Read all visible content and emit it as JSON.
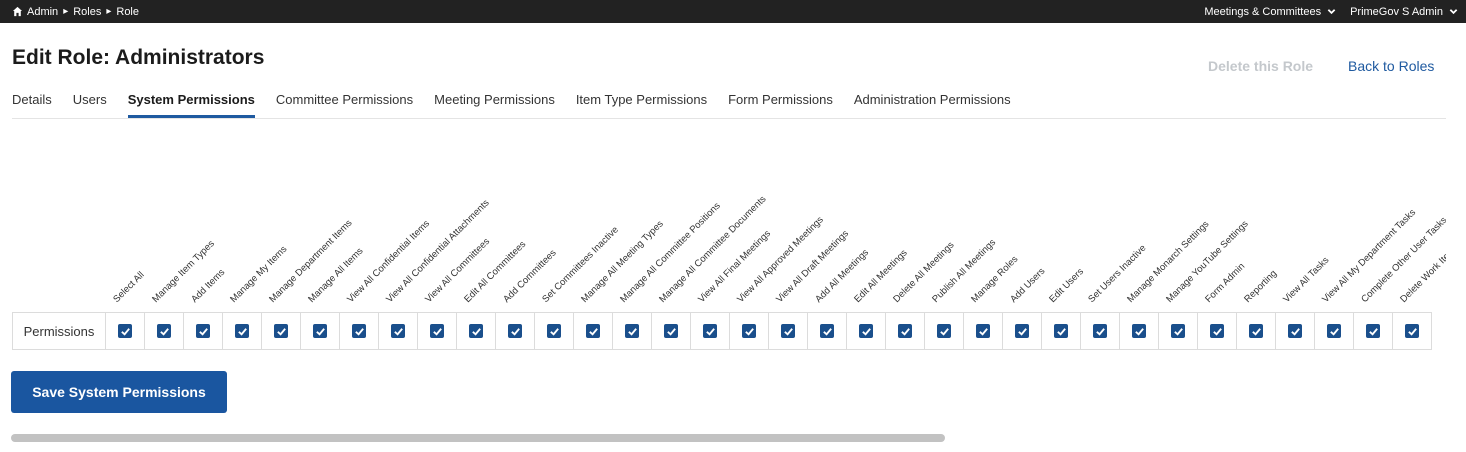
{
  "breadcrumb": [
    "Admin",
    "Roles",
    "Role"
  ],
  "topbar": {
    "meetings_menu": "Meetings & Committees",
    "user_menu": "PrimeGov S Admin"
  },
  "page": {
    "title": "Edit Role: Administrators",
    "delete_link": "Delete this Role",
    "back_link": "Back to Roles"
  },
  "tabs": [
    "Details",
    "Users",
    "System Permissions",
    "Committee Permissions",
    "Meeting Permissions",
    "Item Type Permissions",
    "Form Permissions",
    "Administration Permissions"
  ],
  "active_tab": "System Permissions",
  "permissions": {
    "row_label": "Permissions",
    "columns": [
      "Select All",
      "Manage Item Types",
      "Add Items",
      "Manage My Items",
      "Manage Department Items",
      "Manage All Items",
      "View All Confidential Items",
      "View All Confidential Attachments",
      "View All Committees",
      "Edit All Committees",
      "Add Committees",
      "Set Committees Inactive",
      "Manage All Meeting Types",
      "Manage All Committee Positions",
      "Manage All Committee Documents",
      "View All Final Meetings",
      "View All Approved Meetings",
      "View All Draft Meetings",
      "Add All Meetings",
      "Edit All Meetings",
      "Delete All Meetings",
      "Publish All Meetings",
      "Manage Roles",
      "Add Users",
      "Edit Users",
      "Set Users Inactive",
      "Manage Monarch Settings",
      "Manage YouTube Settings",
      "Form Admin",
      "Reporting",
      "View All Tasks",
      "View All My Department Tasks",
      "Complete Other User Tasks",
      "Delete Work Items"
    ],
    "checked": true
  },
  "save_button": "Save System Permissions",
  "colors": {
    "accent": "#1f5aa0",
    "checkbox": "#1a4f8c",
    "topbar": "#222222"
  }
}
